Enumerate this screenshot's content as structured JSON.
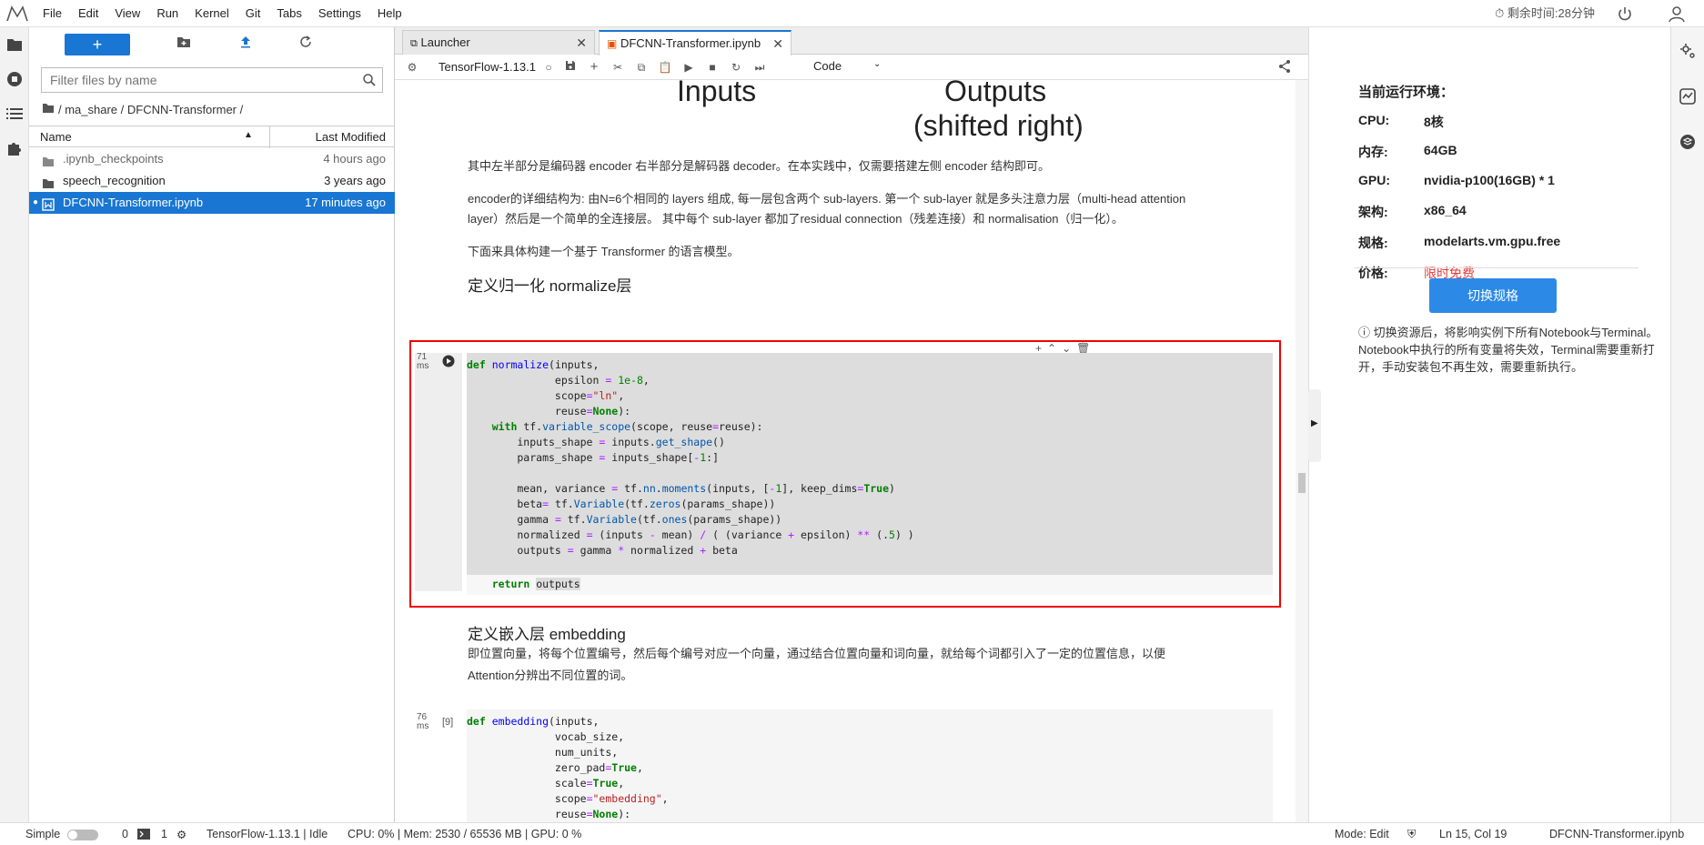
{
  "menubar": {
    "items": [
      "File",
      "Edit",
      "View",
      "Run",
      "Kernel",
      "Git",
      "Tabs",
      "Settings",
      "Help"
    ],
    "timer": "剩余时间:28分钟"
  },
  "filebrowser": {
    "search_placeholder": "Filter files by name",
    "breadcrumb": "/ ma_share / DFCNN-Transformer /",
    "col_name": "Name",
    "col_modified": "Last Modified",
    "files": [
      {
        "name": ".ipynb_checkpoints",
        "modified": "4 hours ago"
      },
      {
        "name": "speech_recognition",
        "modified": "3 years ago"
      },
      {
        "name": "DFCNN-Transformer.ipynb",
        "modified": "17 minutes ago"
      }
    ]
  },
  "tabs": [
    {
      "label": "Launcher"
    },
    {
      "label": "DFCNN-Transformer.ipynb"
    }
  ],
  "nbtoolbar": {
    "kernel": "TensorFlow-1.13.1",
    "cell_type": "Code"
  },
  "notebook": {
    "fig_inputs": "Inputs",
    "fig_outputs": "Outputs",
    "fig_shifted": "(shifted right)",
    "p1": "其中左半部分是编码器 encoder 右半部分是解码器 decoder。在本实践中，仅需要搭建左侧 encoder 结构即可。",
    "p2a": "encoder的详细结构为: 由N=6个相同的 layers 组成, 每一层包含两个 sub-layers. 第一个 sub-layer 就是多头注意力层（multi-head attention",
    "p2b": "layer）然后是一个简单的全连接层。 其中每个 sub-layer 都加了residual connection（残差连接）和 normalisation（归一化）。",
    "p3": "下面来具体构建一个基于 Transformer 的语言模型。",
    "h1": "定义归一化 normalize层",
    "cell1_time_a": "71",
    "cell1_time_b": "ms",
    "h2": "定义嵌入层 embedding",
    "p4a": "即位置向量，将每个位置编号，然后每个编号对应一个向量，通过结合位置向量和词向量，就给每个词都引入了一定的位置信息，以便",
    "p4b": "Attention分辨出不同位置的词。",
    "cell2_time_a": "76",
    "cell2_time_b": "ms",
    "cell2_count": "[9]"
  },
  "rightpanel": {
    "title": "当前运行环境：",
    "rows": [
      {
        "label": "CPU:",
        "value": "8核"
      },
      {
        "label": "内存:",
        "value": "64GB"
      },
      {
        "label": "GPU:",
        "value": "nvidia-p100(16GB) * 1"
      },
      {
        "label": "架构:",
        "value": "x86_64"
      },
      {
        "label": "规格:",
        "value": "modelarts.vm.gpu.free"
      },
      {
        "label": "价格:",
        "value": "限时免费"
      }
    ],
    "price_color": "#e53935",
    "button": "切换规格",
    "note": "切换资源后，将影响实例下所有Notebook与Terminal。Notebook中执行的所有变量将失效，Terminal需要重新打开，手动安装包不再生效，需要重新执行。"
  },
  "statusbar": {
    "simple": "Simple",
    "count1": "0",
    "count2": "1",
    "kernel_status": "TensorFlow-1.13.1 | Idle",
    "resources": "CPU: 0% | Mem: 2530 / 65536 MB | GPU: 0 %",
    "mode": "Mode: Edit",
    "position": "Ln 15, Col 19",
    "filename": "DFCNN-Transformer.ipynb"
  }
}
